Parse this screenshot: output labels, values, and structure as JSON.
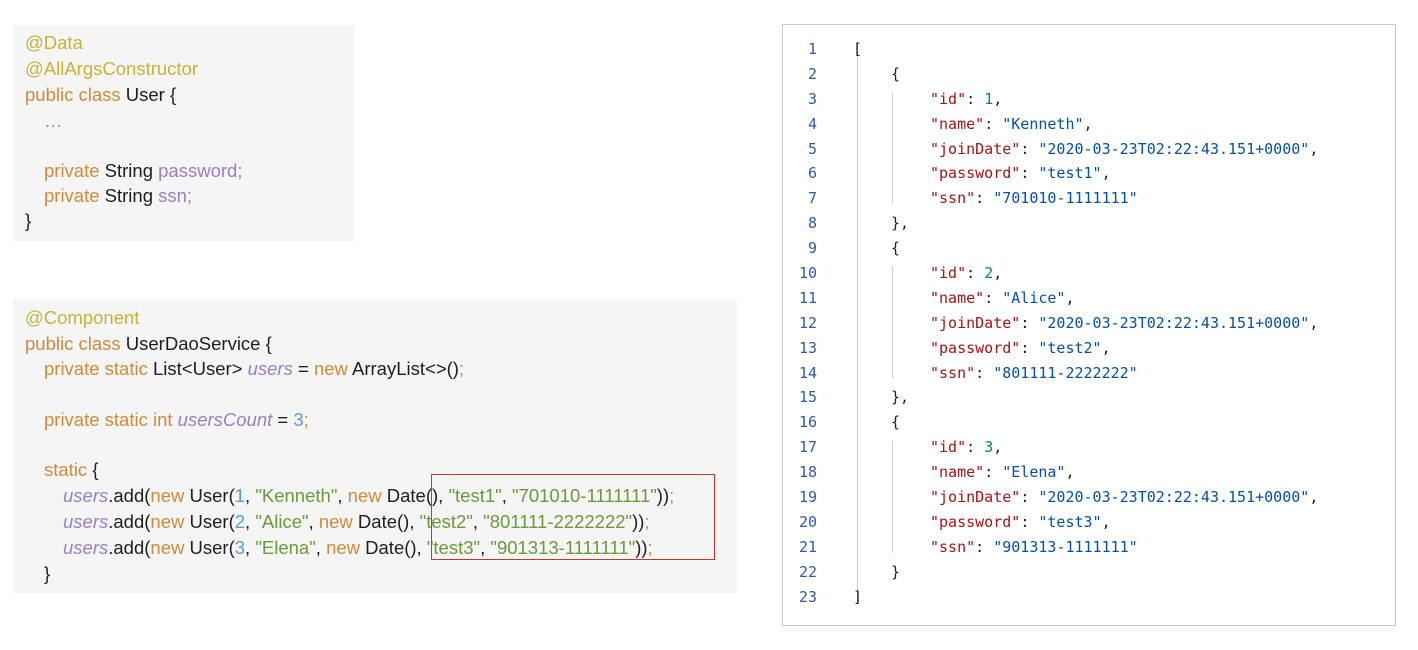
{
  "snippet1": {
    "ann_data": "@Data",
    "ann_ctor": "@AllArgsConstructor",
    "l3_kw": "public class",
    "l3_rest": " User {",
    "ellipsis": "…",
    "l6_kw": "private",
    "l6_type": " String ",
    "l6_field": "password;",
    "l7_kw": "private",
    "l7_type": " String ",
    "l7_field": "ssn;",
    "close": "}"
  },
  "snippet2": {
    "annotation": "@Component",
    "l2_kw": "public class",
    "l2_rest": " UserDaoService {",
    "l3_kw": "private static",
    "l3_a": " List<User> ",
    "l3_field": "users",
    "l3_b": " = ",
    "l3_new": "new",
    "l3_c": " ArrayList<>()",
    "l3_semi": ";",
    "l5_kw": "private static int",
    "l5_sp": " ",
    "l5_field": "usersCount",
    "l5_eq": " = ",
    "l5_num": "3",
    "l5_semi": ";",
    "static_kw": "static",
    "static_brace": " {",
    "rows": [
      {
        "users": "users",
        "add": ".add(",
        "new1": "new",
        "ctor": " User(",
        "num": "1",
        "c1": ", ",
        "name": "\"Kenneth\"",
        "c2": ", ",
        "new2": "new",
        "date": " Date(), ",
        "pw": "\"test1\"",
        "c3": ", ",
        "ssn": "\"701010-1111111\"",
        "end": "))",
        "semi": ";"
      },
      {
        "users": "users",
        "add": ".add(",
        "new1": "new",
        "ctor": " User(",
        "num": "2",
        "c1": ", ",
        "name": "\"Alice\"",
        "c2": ", ",
        "new2": "new",
        "date": " Date(), ",
        "pw": "\"test2\"",
        "c3": ", ",
        "ssn": "\"801111-2222222\"",
        "end": "))",
        "semi": ";"
      },
      {
        "users": "users",
        "add": ".add(",
        "new1": "new",
        "ctor": " User(",
        "num": "3",
        "c1": ", ",
        "name": "\"Elena\"",
        "c2": ", ",
        "new2": "new",
        "date": " Date(), ",
        "pw": "\"test3\"",
        "c3": ", ",
        "ssn": "\"901313-1111111\"",
        "end": "))",
        "semi": ";"
      }
    ],
    "close": "}"
  },
  "json_viewer": {
    "open_bracket": "[",
    "close_bracket": "]",
    "open_brace": "{",
    "close_brace_comma": "},",
    "close_brace": "}",
    "line_numbers": [
      "1",
      "2",
      "3",
      "4",
      "5",
      "6",
      "7",
      "8",
      "9",
      "10",
      "11",
      "12",
      "13",
      "14",
      "15",
      "16",
      "17",
      "18",
      "19",
      "20",
      "21",
      "22",
      "23"
    ],
    "keys": {
      "id": "\"id\"",
      "name": "\"name\"",
      "joinDate": "\"joinDate\"",
      "password": "\"password\"",
      "ssn": "\"ssn\""
    },
    "records": [
      {
        "id": "1",
        "name": "\"Kenneth\"",
        "joinDate": "\"2020-03-23T02:22:43.151+0000\"",
        "password": "\"test1\"",
        "ssn": "\"701010-1111111\""
      },
      {
        "id": "2",
        "name": "\"Alice\"",
        "joinDate": "\"2020-03-23T02:22:43.151+0000\"",
        "password": "\"test2\"",
        "ssn": "\"801111-2222222\""
      },
      {
        "id": "3",
        "name": "\"Elena\"",
        "joinDate": "\"2020-03-23T02:22:43.151+0000\"",
        "password": "\"test3\"",
        "ssn": "\"901313-1111111\""
      }
    ]
  }
}
